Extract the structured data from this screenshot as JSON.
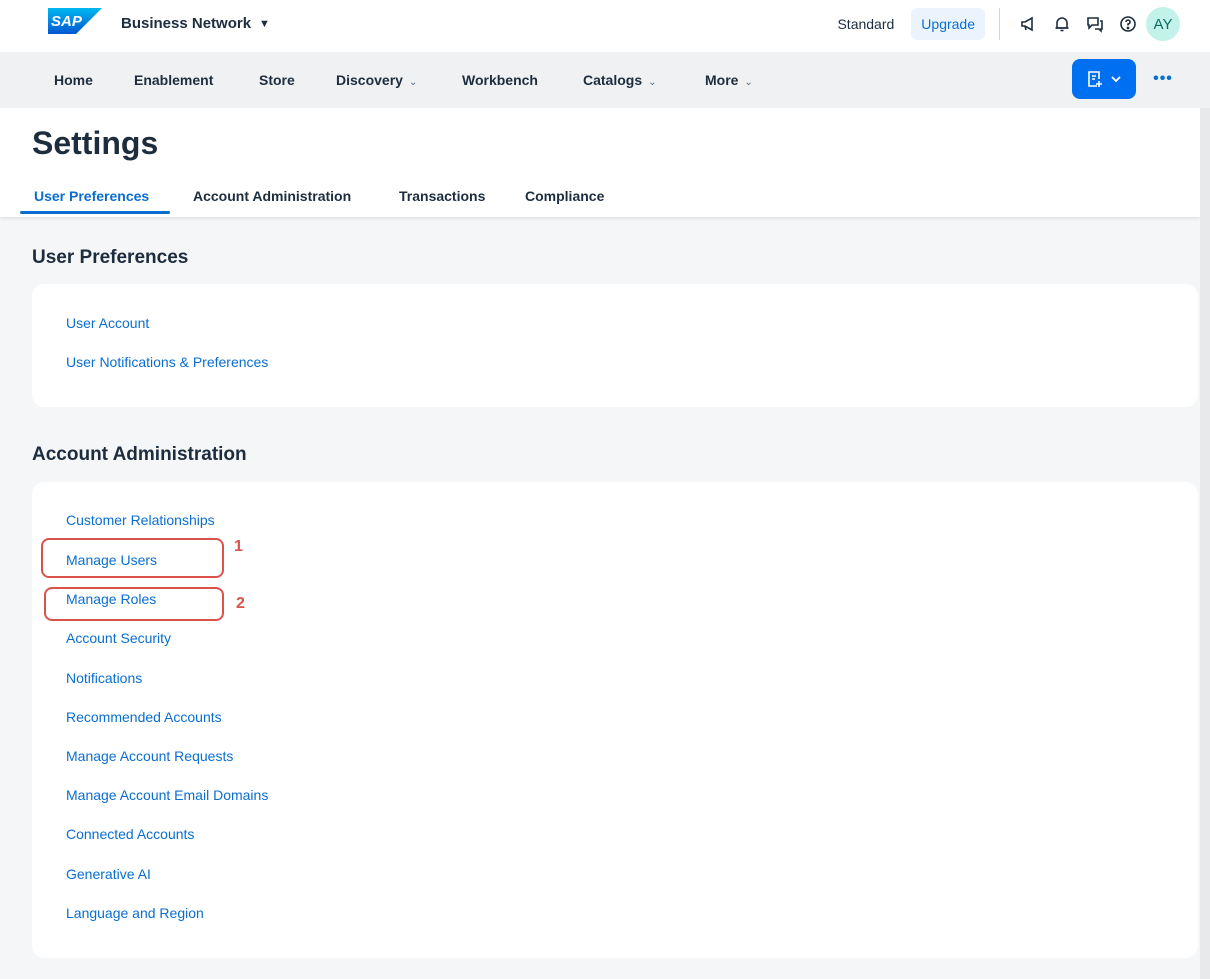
{
  "shell": {
    "logo_text": "SAP",
    "product_name": "Business Network",
    "product_caret": "▼",
    "mode": "Standard",
    "upgrade_label": "Upgrade",
    "avatar_initials": "AY",
    "icons": [
      "announcement-icon",
      "notification-bell-icon",
      "messages-icon",
      "help-icon"
    ]
  },
  "nav": {
    "items": [
      {
        "label": "Home"
      },
      {
        "label": "Enablement"
      },
      {
        "label": "Store"
      },
      {
        "label": "Discovery",
        "chevron": "⌄"
      },
      {
        "label": "Workbench"
      },
      {
        "label": "Catalogs",
        "chevron": "⌄"
      },
      {
        "label": "More",
        "chevron": "⌄"
      }
    ],
    "more_dots": "•••"
  },
  "header": {
    "title": "Settings",
    "tabs": [
      {
        "label": "User Preferences",
        "active": true
      },
      {
        "label": "Account Administration"
      },
      {
        "label": "Transactions"
      },
      {
        "label": "Compliance"
      }
    ]
  },
  "sections": {
    "user_preferences": {
      "title": "User Preferences",
      "links": [
        "User Account",
        "User Notifications & Preferences"
      ]
    },
    "account_administration": {
      "title": "Account Administration",
      "links": [
        "Customer Relationships",
        "Manage Users",
        "Manage Roles",
        "Account Security",
        "Notifications",
        "Recommended Accounts",
        "Manage Account Requests",
        "Manage Account Email Domains",
        "Connected Accounts",
        "Generative AI",
        "Language and Region"
      ]
    }
  },
  "annotations": {
    "marker_1": "1",
    "marker_2": "2"
  },
  "colors": {
    "accent": "#0a6ed1",
    "brand_button": "#0070f2",
    "highlight": "#d9534a",
    "avatar_bg": "#c2f2ea"
  }
}
